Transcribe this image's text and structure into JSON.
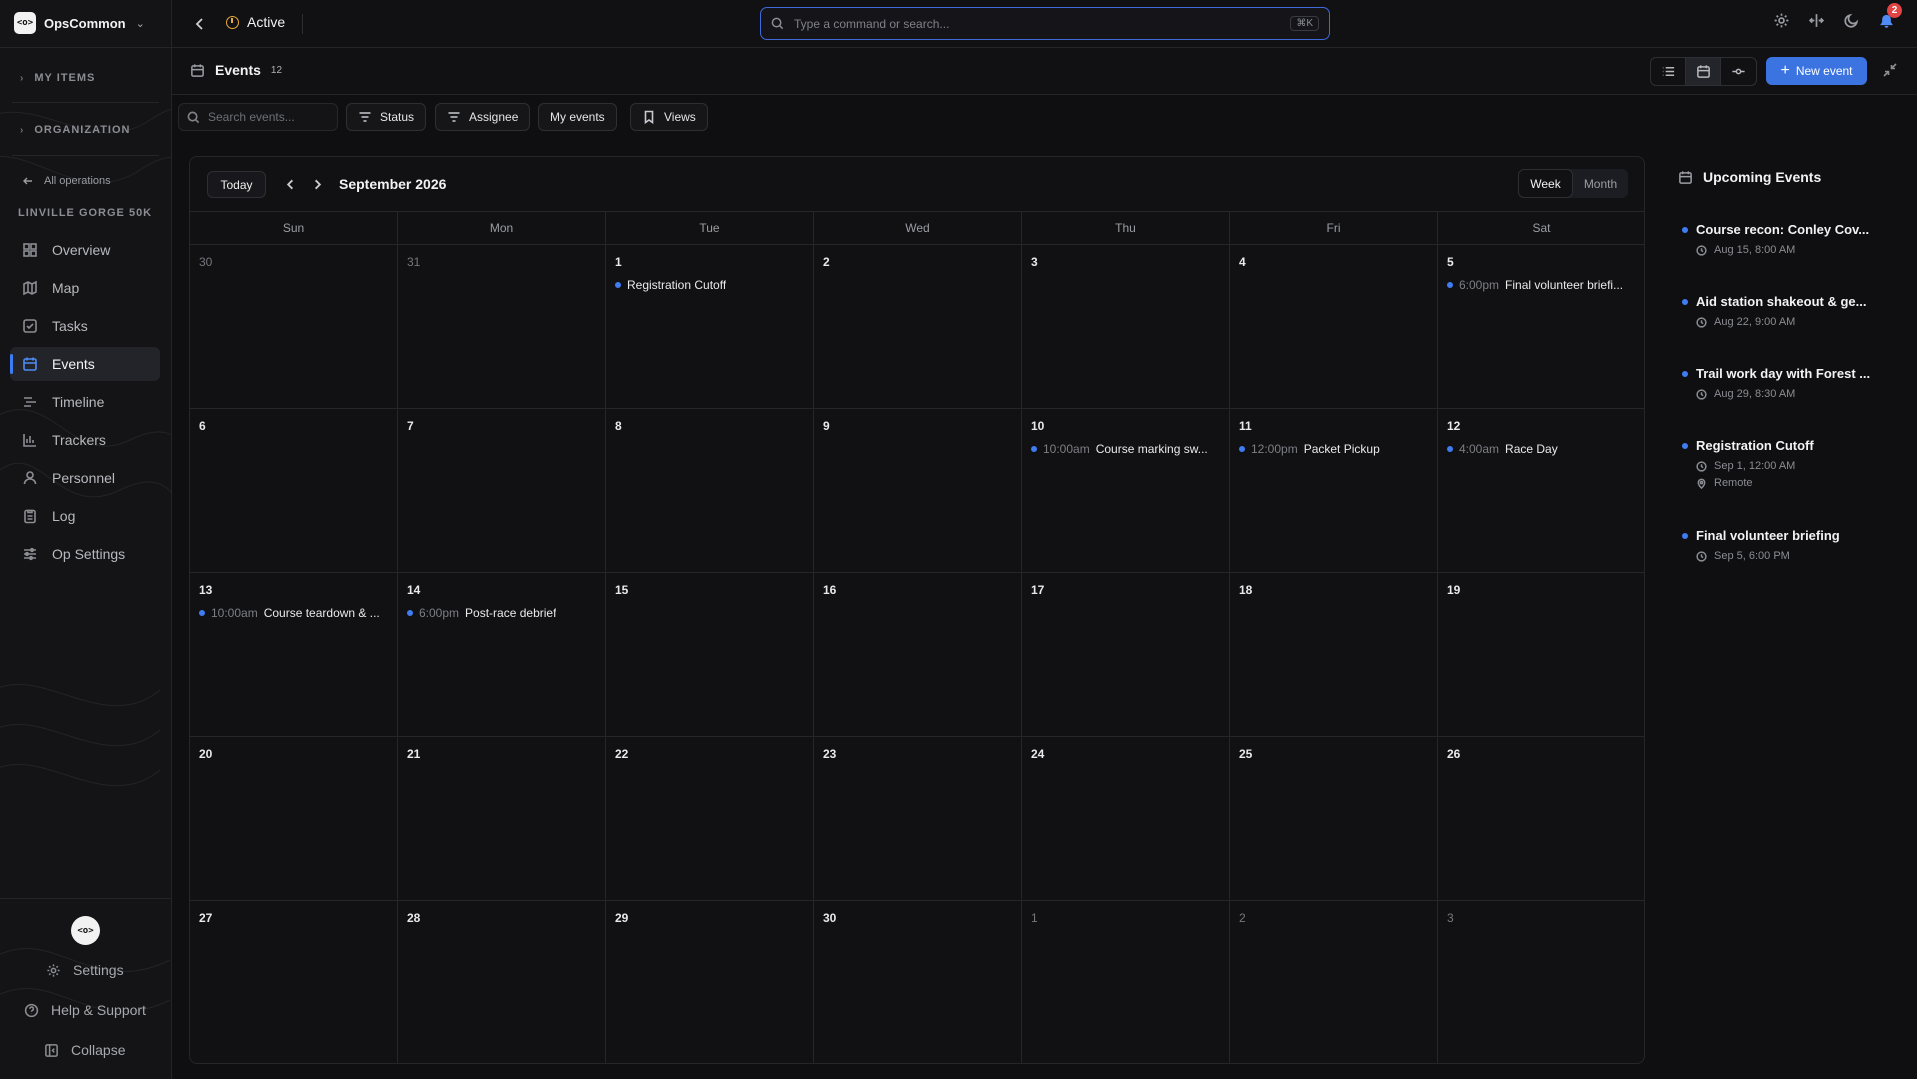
{
  "sidebar": {
    "brand": "OpsCommon",
    "logo_text": "<o>",
    "sections": {
      "my_items": "MY ITEMS",
      "organization": "ORGANIZATION"
    },
    "back_link": "All operations",
    "operation_name": "LINVILLE GORGE 50K",
    "nav": [
      {
        "label": "Overview",
        "icon": "grid-icon"
      },
      {
        "label": "Map",
        "icon": "map-icon"
      },
      {
        "label": "Tasks",
        "icon": "checkbox-icon"
      },
      {
        "label": "Events",
        "icon": "calendar-icon",
        "active": true
      },
      {
        "label": "Timeline",
        "icon": "timeline-icon"
      },
      {
        "label": "Trackers",
        "icon": "bar-chart-icon"
      },
      {
        "label": "Personnel",
        "icon": "person-icon"
      },
      {
        "label": "Log",
        "icon": "clipboard-icon"
      },
      {
        "label": "Op Settings",
        "icon": "sliders-icon"
      }
    ],
    "footer": {
      "settings": "Settings",
      "help": "Help & Support",
      "collapse": "Collapse"
    }
  },
  "topbar": {
    "status": "Active",
    "command_placeholder": "Type a command or search...",
    "command_shortcut": "⌘K",
    "notification_count": "2"
  },
  "header": {
    "title": "Events",
    "count": "12",
    "new_event": "New event"
  },
  "filters": {
    "search_placeholder": "Search events...",
    "status": "Status",
    "assignee": "Assignee",
    "my_events": "My events",
    "views": "Views"
  },
  "calendar": {
    "today": "Today",
    "month_title": "September 2026",
    "view_week": "Week",
    "view_month": "Month",
    "active_view": "Week",
    "weekdays": [
      "Sun",
      "Mon",
      "Tue",
      "Wed",
      "Thu",
      "Fri",
      "Sat"
    ],
    "weeks": [
      [
        {
          "day": "30",
          "muted": true
        },
        {
          "day": "31",
          "muted": true
        },
        {
          "day": "1",
          "event": {
            "time": "",
            "title": "Registration Cutoff"
          }
        },
        {
          "day": "2"
        },
        {
          "day": "3"
        },
        {
          "day": "4"
        },
        {
          "day": "5",
          "event": {
            "time": "6:00pm",
            "title": "Final volunteer briefi..."
          }
        }
      ],
      [
        {
          "day": "6"
        },
        {
          "day": "7"
        },
        {
          "day": "8"
        },
        {
          "day": "9"
        },
        {
          "day": "10",
          "event": {
            "time": "10:00am",
            "title": "Course marking sw..."
          }
        },
        {
          "day": "11",
          "event": {
            "time": "12:00pm",
            "title": "Packet Pickup"
          }
        },
        {
          "day": "12",
          "event": {
            "time": "4:00am",
            "title": "Race Day"
          }
        }
      ],
      [
        {
          "day": "13",
          "event": {
            "time": "10:00am",
            "title": "Course teardown & ..."
          }
        },
        {
          "day": "14",
          "event": {
            "time": "6:00pm",
            "title": "Post-race debrief"
          }
        },
        {
          "day": "15"
        },
        {
          "day": "16"
        },
        {
          "day": "17"
        },
        {
          "day": "18"
        },
        {
          "day": "19"
        }
      ],
      [
        {
          "day": "20"
        },
        {
          "day": "21"
        },
        {
          "day": "22"
        },
        {
          "day": "23"
        },
        {
          "day": "24"
        },
        {
          "day": "25"
        },
        {
          "day": "26"
        }
      ],
      [
        {
          "day": "27"
        },
        {
          "day": "28"
        },
        {
          "day": "29"
        },
        {
          "day": "30"
        },
        {
          "day": "1",
          "muted": true
        },
        {
          "day": "2",
          "muted": true
        },
        {
          "day": "3",
          "muted": true
        }
      ]
    ]
  },
  "upcoming": {
    "title": "Upcoming Events",
    "items": [
      {
        "title": "Course recon: Conley Cov...",
        "when": "Aug 15, 8:00 AM"
      },
      {
        "title": "Aid station shakeout & ge...",
        "when": "Aug 22, 9:00 AM"
      },
      {
        "title": "Trail work day with Forest ...",
        "when": "Aug 29, 8:30 AM"
      },
      {
        "title": "Registration Cutoff",
        "when": "Sep 1, 12:00 AM",
        "location": "Remote"
      },
      {
        "title": "Final volunteer briefing",
        "when": "Sep 5, 6:00 PM"
      }
    ]
  },
  "colors": {
    "accent": "#3d7cf2",
    "status_active": "#e5a93a",
    "badge": "#e04444",
    "background": "#0f0f12"
  }
}
